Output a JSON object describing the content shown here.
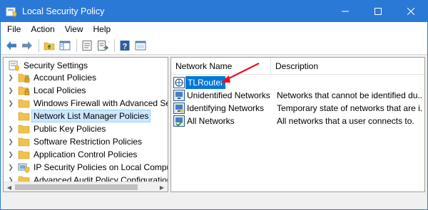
{
  "window": {
    "title": "Local Security Policy",
    "controls": {
      "minimize": "—",
      "maximize": "☐",
      "close": "✕"
    }
  },
  "menubar": {
    "items": [
      "File",
      "Action",
      "View",
      "Help"
    ]
  },
  "toolbar": {
    "buttons": [
      "back-icon",
      "forward-icon",
      "up-folder-icon",
      "show-tree-icon",
      "properties-icon",
      "export-list-icon",
      "help-icon",
      "console-icon"
    ]
  },
  "tree": {
    "root": "Security Settings",
    "items": [
      {
        "label": "Account Policies",
        "selected": false
      },
      {
        "label": "Local Policies",
        "selected": false
      },
      {
        "label": "Windows Firewall with Advanced Secu",
        "selected": false
      },
      {
        "label": "Network List Manager Policies",
        "selected": true
      },
      {
        "label": "Public Key Policies",
        "selected": false
      },
      {
        "label": "Software Restriction Policies",
        "selected": false
      },
      {
        "label": "Application Control Policies",
        "selected": false
      },
      {
        "label": "IP Security Policies on Local Compute",
        "selected": false
      },
      {
        "label": "Advanced Audit Policy Configuration",
        "selected": false
      }
    ]
  },
  "list": {
    "columns": [
      "Network Name",
      "Description"
    ],
    "rows": [
      {
        "name": "TLRouter",
        "description": "",
        "selected": true
      },
      {
        "name": "Unidentified Networks",
        "description": "Networks that cannot be identified du...",
        "selected": false
      },
      {
        "name": "Identifying Networks",
        "description": "Temporary state of networks that are i...",
        "selected": false
      },
      {
        "name": "All Networks",
        "description": "All networks that a user connects to.",
        "selected": false
      }
    ]
  },
  "colors": {
    "titlebar": "#2b79d7",
    "selection": "#0078d7",
    "tree_selection": "#cce8ff",
    "annotation_arrow": "#e81123"
  }
}
